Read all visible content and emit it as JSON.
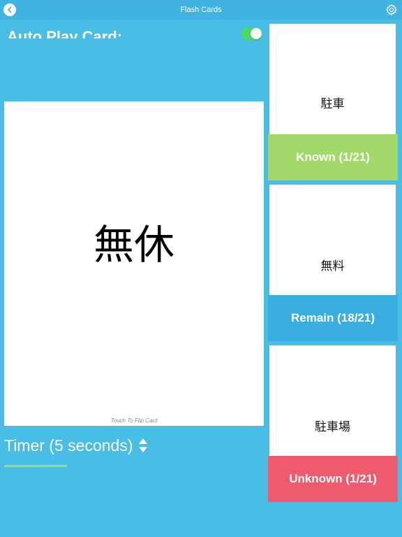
{
  "nav": {
    "title": "Flash Cards",
    "back_icon": "chevron-left-icon",
    "settings_icon": "gear-icon"
  },
  "autoplay": {
    "label": "Auto Play Card:",
    "enabled": true
  },
  "main_card": {
    "word": "無休",
    "hint": "Touch To Flip Card"
  },
  "timer": {
    "label": "Timer (5 seconds)",
    "stepper_icon": "up-down-stepper-icon"
  },
  "piles": [
    {
      "card_word": "駐車",
      "label": "Known (1/21)",
      "color": "#a3d86a"
    },
    {
      "card_word": "無料",
      "label": "Remain (18/21)",
      "color": "#3aaee0"
    },
    {
      "card_word": "駐車場",
      "label": "Unknown (1/21)",
      "color": "#ee5a6e"
    }
  ],
  "colors": {
    "background": "#48bde6",
    "toggle_on": "#4cd964",
    "card": "#ffffff"
  }
}
